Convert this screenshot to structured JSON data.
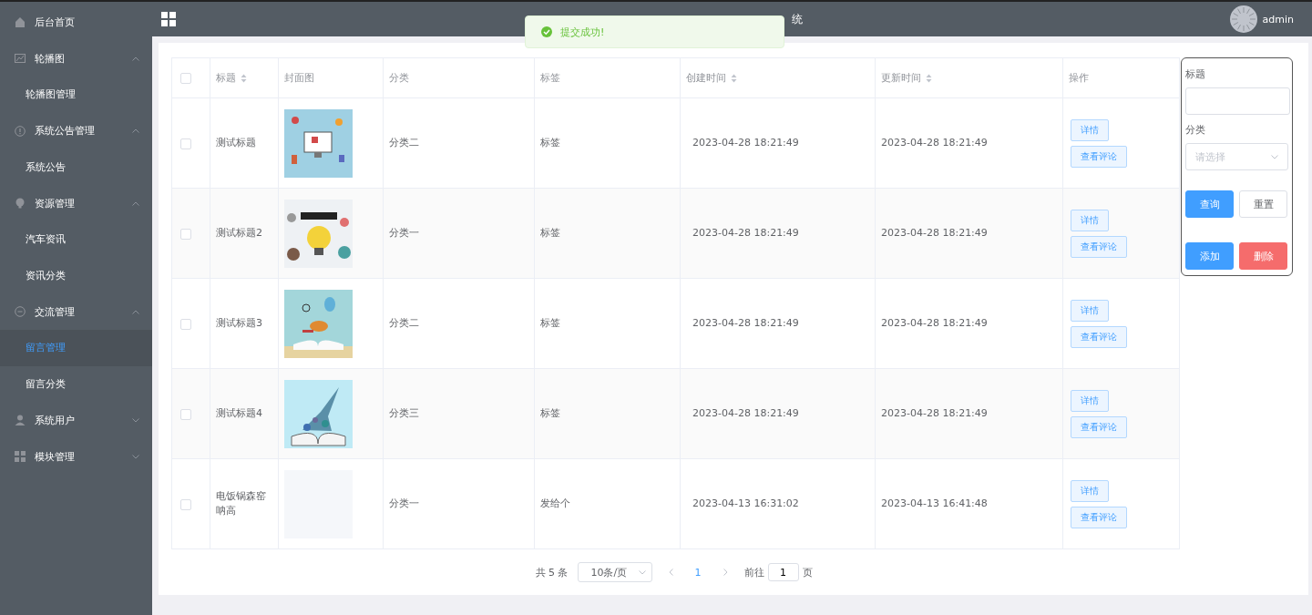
{
  "sidebar": {
    "items": [
      {
        "label": "后台首页"
      },
      {
        "label": "轮播图",
        "expanded": true,
        "children": [
          {
            "label": "轮播图管理",
            "selected": false
          }
        ]
      },
      {
        "label": "系统公告管理",
        "expanded": true,
        "children": [
          {
            "label": "系统公告",
            "selected": false
          }
        ]
      },
      {
        "label": "资源管理",
        "expanded": true,
        "children": [
          {
            "label": "汽车资讯",
            "selected": false
          },
          {
            "label": "资讯分类",
            "selected": false
          }
        ]
      },
      {
        "label": "交流管理",
        "expanded": true,
        "children": [
          {
            "label": "留言管理",
            "selected": true
          },
          {
            "label": "留言分类",
            "selected": false
          }
        ]
      },
      {
        "label": "系统用户",
        "expanded": false
      },
      {
        "label": "模块管理",
        "expanded": false
      }
    ]
  },
  "header": {
    "title": "统",
    "user": "admin"
  },
  "toast": {
    "message": "提交成功!"
  },
  "table": {
    "columns": [
      {
        "kind": "check",
        "checked": false
      },
      {
        "label": "标题",
        "sortable": true
      },
      {
        "label": "封面图",
        "sortable": false
      },
      {
        "label": "分类",
        "sortable": false
      },
      {
        "label": "标签",
        "sortable": false
      },
      {
        "label": "创建时间",
        "sortable": true
      },
      {
        "label": "更新时间",
        "sortable": true
      },
      {
        "label": "操作",
        "sortable": false
      }
    ],
    "rows": [
      {
        "checked": false,
        "title": "测试标题",
        "category": "分类二",
        "tag": "标签",
        "created": "2023-04-28 18:21:49",
        "updated": "2023-04-28 18:21:49",
        "actions": [
          "详情",
          "查看评论"
        ]
      },
      {
        "checked": false,
        "title": "测试标题2",
        "category": "分类一",
        "tag": "标签",
        "created": "2023-04-28 18:21:49",
        "updated": "2023-04-28 18:21:49",
        "actions": [
          "详情",
          "查看评论"
        ]
      },
      {
        "checked": false,
        "title": "测试标题3",
        "category": "分类二",
        "tag": "标签",
        "created": "2023-04-28 18:21:49",
        "updated": "2023-04-28 18:21:49",
        "actions": [
          "详情",
          "查看评论"
        ]
      },
      {
        "checked": false,
        "title": "测试标题4",
        "category": "分类三",
        "tag": "标签",
        "created": "2023-04-28 18:21:49",
        "updated": "2023-04-28 18:21:49",
        "actions": [
          "详情",
          "查看评论"
        ]
      },
      {
        "checked": false,
        "title": "电饭锅森窑呐高",
        "cover": {
          "kind": "empty"
        },
        "category": "分类一",
        "tag": "发给个",
        "created": "2023-04-13 16:31:02",
        "updated": "2023-04-13 16:41:48",
        "actions": [
          "详情",
          "查看评论"
        ]
      }
    ]
  },
  "pagination": {
    "total": "共 5 条",
    "page_size": "10条/页",
    "pages": [
      {
        "label": "1",
        "selected": true
      }
    ],
    "goto_label": "前往",
    "goto_value": "1",
    "goto_suffix": "页"
  },
  "search_panel": {
    "fields": [
      {
        "kind": "input",
        "label": "标题"
      },
      {
        "kind": "select",
        "label": "分类",
        "placeholder": "请选择"
      }
    ],
    "buttons": [
      {
        "label": "查询",
        "kind": "primary"
      },
      {
        "label": "重置",
        "kind": "plain"
      },
      {
        "label": "添加",
        "kind": "primary"
      },
      {
        "label": "删除",
        "kind": "danger"
      }
    ]
  }
}
